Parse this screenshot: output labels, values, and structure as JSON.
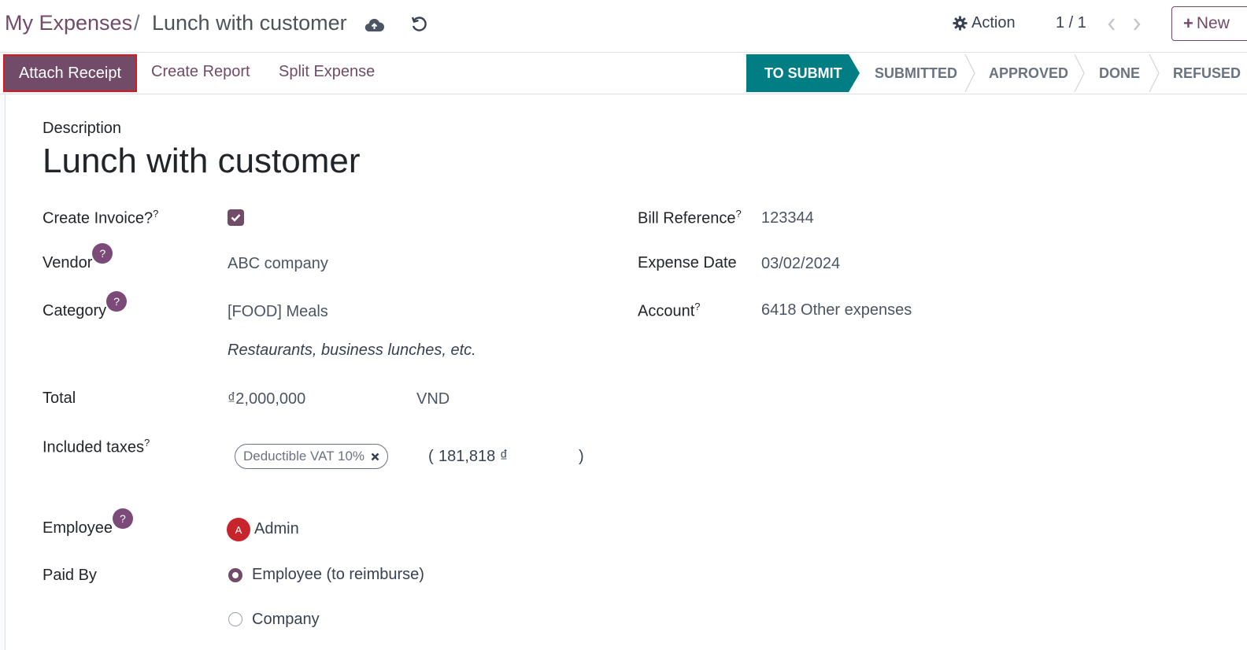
{
  "breadcrumb": {
    "parent": "My Expenses",
    "separator": "/",
    "current": "Lunch with customer"
  },
  "header": {
    "action_label": "Action",
    "pager": "1 / 1",
    "new_label": "New"
  },
  "buttons": {
    "attach_receipt": "Attach Receipt",
    "create_report": "Create Report",
    "split_expense": "Split Expense"
  },
  "statusbar": {
    "stages": [
      "TO SUBMIT",
      "SUBMITTED",
      "APPROVED",
      "DONE",
      "REFUSED"
    ],
    "active": "TO SUBMIT",
    "active_color": "#017e84"
  },
  "form": {
    "description_label": "Description",
    "description": "Lunch with customer",
    "create_invoice_label": "Create Invoice?",
    "create_invoice_checked": true,
    "vendor_label": "Vendor",
    "vendor": "ABC company",
    "category_label": "Category",
    "category": "[FOOD] Meals",
    "category_note": "Restaurants, business lunches, etc.",
    "total_label": "Total",
    "total": "₫2,000,000",
    "currency": "VND",
    "included_taxes_label": "Included taxes",
    "tax_tag": "Deductible VAT 10%",
    "tax_open": "(",
    "tax_amount": "181,818 ₫",
    "tax_close": ")",
    "employee_label": "Employee",
    "employee_initial": "A",
    "employee": "Admin",
    "paid_by_label": "Paid By",
    "paid_by_options": [
      "Employee (to reimburse)",
      "Company"
    ],
    "paid_by_selected": "Employee (to reimburse)",
    "bill_reference_label": "Bill Reference",
    "bill_reference": "123344",
    "expense_date_label": "Expense Date",
    "expense_date": "03/02/2024",
    "account_label": "Account",
    "account": "6418 Other expenses",
    "tooltip_mark": "?"
  },
  "colors": {
    "brand": "#714b67",
    "badge": "#7b4a79",
    "avatar": "#c8242c",
    "highlight_border": "#e0161b"
  }
}
